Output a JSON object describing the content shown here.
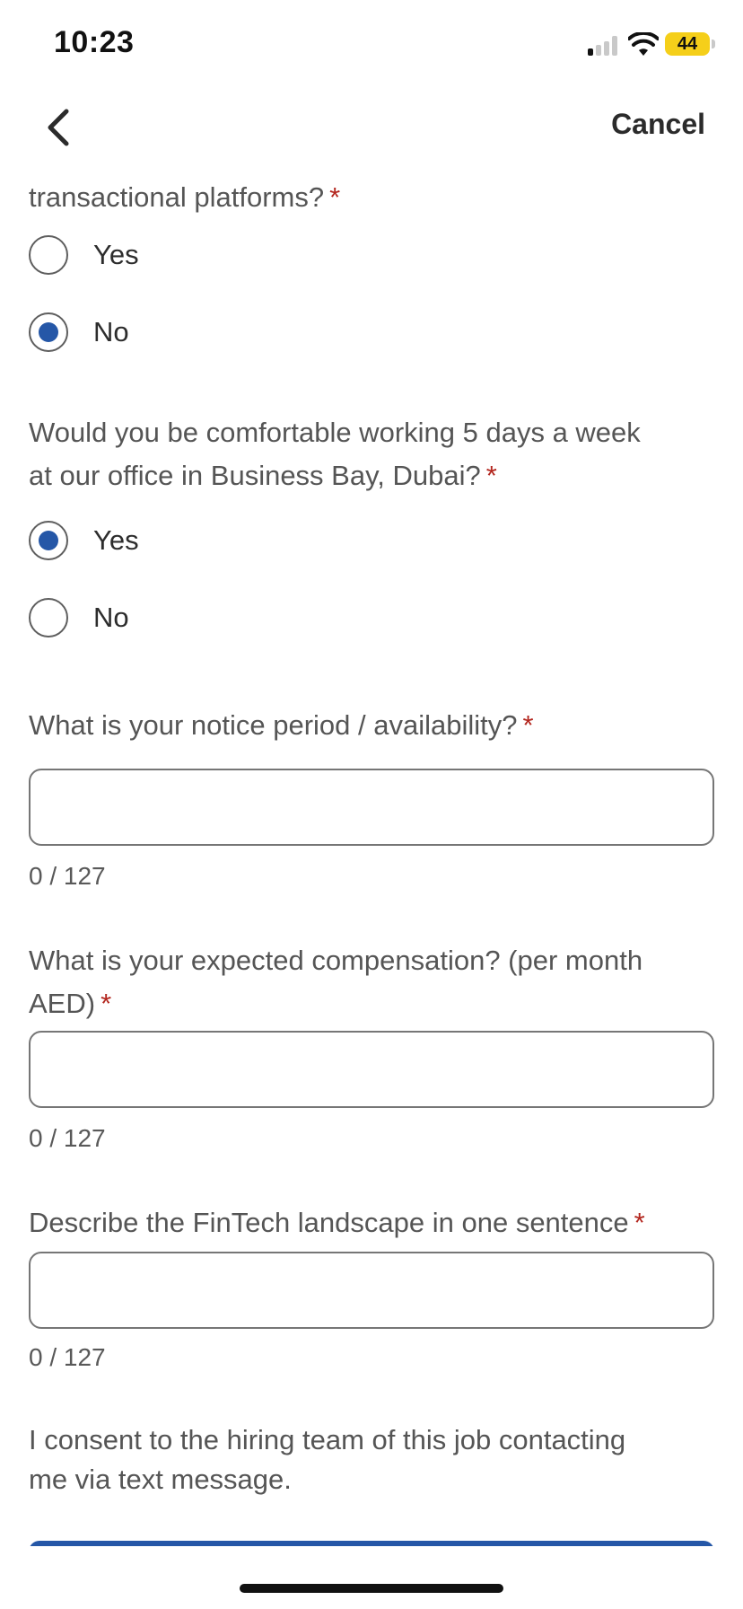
{
  "status_bar": {
    "time": "10:23",
    "battery": "44"
  },
  "nav": {
    "cancel_label": "Cancel"
  },
  "questions": {
    "q1": {
      "text": "transactional platforms?",
      "required_mark": "*",
      "options": [
        "Yes",
        "No"
      ],
      "selected": "No"
    },
    "q2": {
      "line1": "Would you be comfortable working 5 days a week",
      "line2": "at our office in Business Bay, Dubai?",
      "required_mark": "*",
      "options": [
        "Yes",
        "No"
      ],
      "selected": "Yes"
    },
    "q3": {
      "text": "What is your notice period / availability?",
      "required_mark": "*",
      "value": "",
      "counter": "0 / 127"
    },
    "q4": {
      "line1": "What is your expected compensation? (per month",
      "line2": "AED)",
      "required_mark": "*",
      "value": "",
      "counter": "0 / 127"
    },
    "q5": {
      "text": "Describe the FinTech landscape in one sentence",
      "required_mark": "*",
      "value": "",
      "counter": "0 / 127"
    }
  },
  "consent": {
    "line1": "I consent to the hiring team of this job contacting",
    "line2": "me via text message."
  },
  "colors": {
    "accent": "#2557a7",
    "required": "#b3261e",
    "battery": "#f5cf1a"
  },
  "icons": {
    "back": "chevron-left-icon",
    "wifi": "wifi-icon",
    "signal": "cellular-signal-icon",
    "battery": "battery-icon"
  }
}
